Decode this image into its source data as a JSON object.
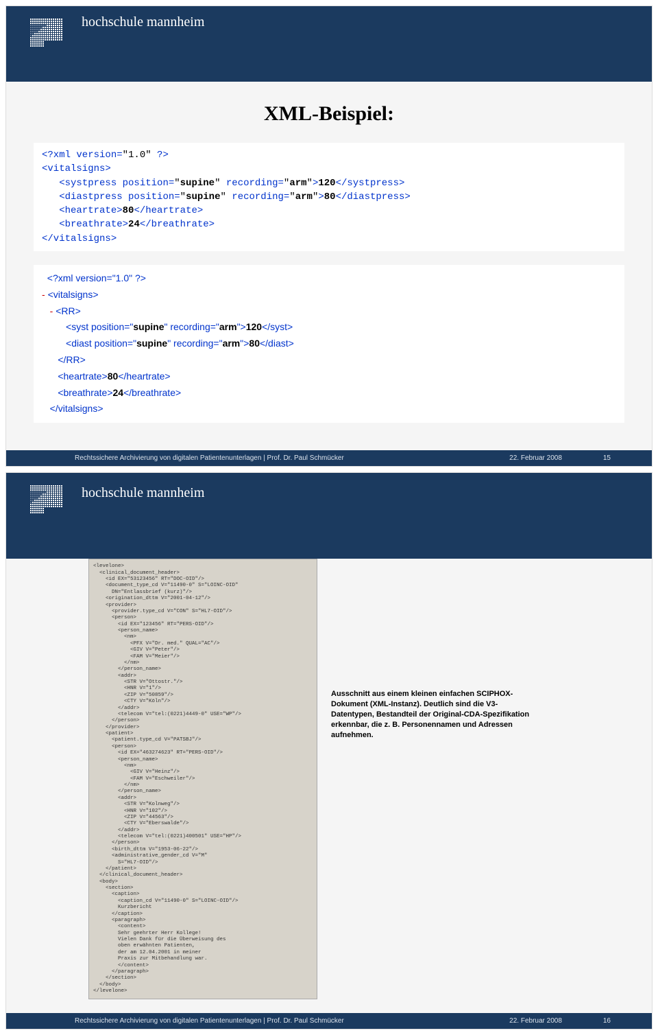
{
  "institution": "hochschule mannheim",
  "slide15": {
    "title": "XML-Beispiel:",
    "xml1": {
      "decl_prefix": "<?xml version=",
      "decl_ver": "\"1.0\"",
      "decl_suffix": " ?>",
      "open_vital": "<vitalsigns>",
      "syst_open": "<systpress position=",
      "pos_val": "\"supine\"",
      "rec_attr": " recording=",
      "rec_val": "\"arm\"",
      "gt": ">",
      "syst_val": "120",
      "syst_close": "</systpress>",
      "diast_open": "<diastpress position=",
      "diast_val": "80",
      "diast_close": "</diastpress>",
      "hr_open": "<heartrate>",
      "hr_val": "80",
      "hr_close": "</heartrate>",
      "br_open": "<breathrate>",
      "br_val": "24",
      "br_close": "</breathrate>",
      "close_vital": "</vitalsigns>"
    },
    "xml2": {
      "decl": "<?xml version=\"1.0\" ?>",
      "minus": "- ",
      "open_vital": "<vitalsigns>",
      "minus2": "- ",
      "rr_open": "<RR>",
      "syst_open": "<syst position=\"",
      "supine": "supine",
      "mid1": "\" recording=\"",
      "arm": "arm",
      "end1": "\">",
      "v120": "120",
      "syst_close": "</syst>",
      "diast_open": "<diast position=\"",
      "v80": "80",
      "diast_close": "</diast>",
      "rr_close": "</RR>",
      "hr_open": "<heartrate>",
      "hr_v": "80",
      "hr_close": "</heartrate>",
      "br_open": "<breathrate>",
      "br_v": "24",
      "br_close": "</breathrate>",
      "close_vital": "</vitalsigns>"
    },
    "pageno": "15"
  },
  "slide16": {
    "xml_clip": "<levelone>\n  <clinical_document_header>\n    <id EX=\"53123456\" RT=\"DOC-OID\"/>\n    <document_type_cd V=\"11490-0\" S=\"LOINC-OID\"\n      DN=\"Entlassbrief (kurz)\"/>\n    <origination_dttm V=\"2001-04-12\"/>\n    <provider>\n      <provider.type_cd V=\"CON\" S=\"HL7-OID\"/>\n      <person>\n        <id EX=\"123456\" RT=\"PERS-OID\"/>\n        <person_name>\n          <nm>\n            <PFX V=\"Dr. med.\" QUAL=\"AC\"/>\n            <GIV V=\"Peter\"/>\n            <FAM V=\"Meier\"/>\n          </nm>\n        </person_name>\n        <addr>\n          <STR V=\"Ottostr.\"/>\n          <HNR V=\"1\"/>\n          <ZIP V=\"50859\"/>\n          <CTY V=\"Köln\"/>\n        </addr>\n        <telecom V=\"tel:(0221)4449-0\" USE=\"WP\"/>\n      </person>\n    </provider>\n    <patient>\n      <patient.type_cd V=\"PATSBJ\"/>\n      <person>\n        <id EX=\"463274623\" RT=\"PERS-OID\"/>\n        <person_name>\n          <nm>\n            <GIV V=\"Heinz\"/>\n            <FAM V=\"Eschweiler\"/>\n          </nm>\n        </person_name>\n        <addr>\n          <STR V=\"Kolnweg\"/>\n          <HNR V=\"102\"/>\n          <ZIP V=\"44563\"/>\n          <CTY V=\"Eberswalde\"/>\n        </addr>\n        <telecom V=\"tel:(0221)400501\" USE=\"HP\"/>\n      </person>\n      <birth_dttm V=\"1953-06-22\"/>\n      <administrative_gender_cd V=\"M\"\n        S=\"HL7-OID\"/>\n    </patient>\n  </clinical_document_header>\n  <body>\n    <section>\n      <caption>\n        <caption_cd V=\"11490-0\" S=\"LOINC-OID\"/>\n        Kurzbericht\n      </caption>\n      <paragraph>\n        <content>\n        Sehr geehrter Herr Kollege!\n        Vielen Dank für die Überweisung des\n        oben erwähnten Patienten,\n        der am 12.04.2001 in meiner\n        Praxis zur Mitbehandlung war.\n        </content>\n      </paragraph>\n    </section>\n  </body>\n</levelone>",
    "caption": "Ausschnitt aus einem kleinen einfachen SCIPHOX-Dokument (XML-Instanz). Deutlich sind die V3-Datentypen, Bestandteil der Original-CDA-Spezifikation erkennbar, die z. B. Personennamen und Adressen aufnehmen.",
    "pageno": "16"
  },
  "footer": {
    "text": "Rechtssichere Archivierung von digitalen Patientenunterlagen | Prof. Dr. Paul Schmücker",
    "date": "22. Februar 2008"
  }
}
